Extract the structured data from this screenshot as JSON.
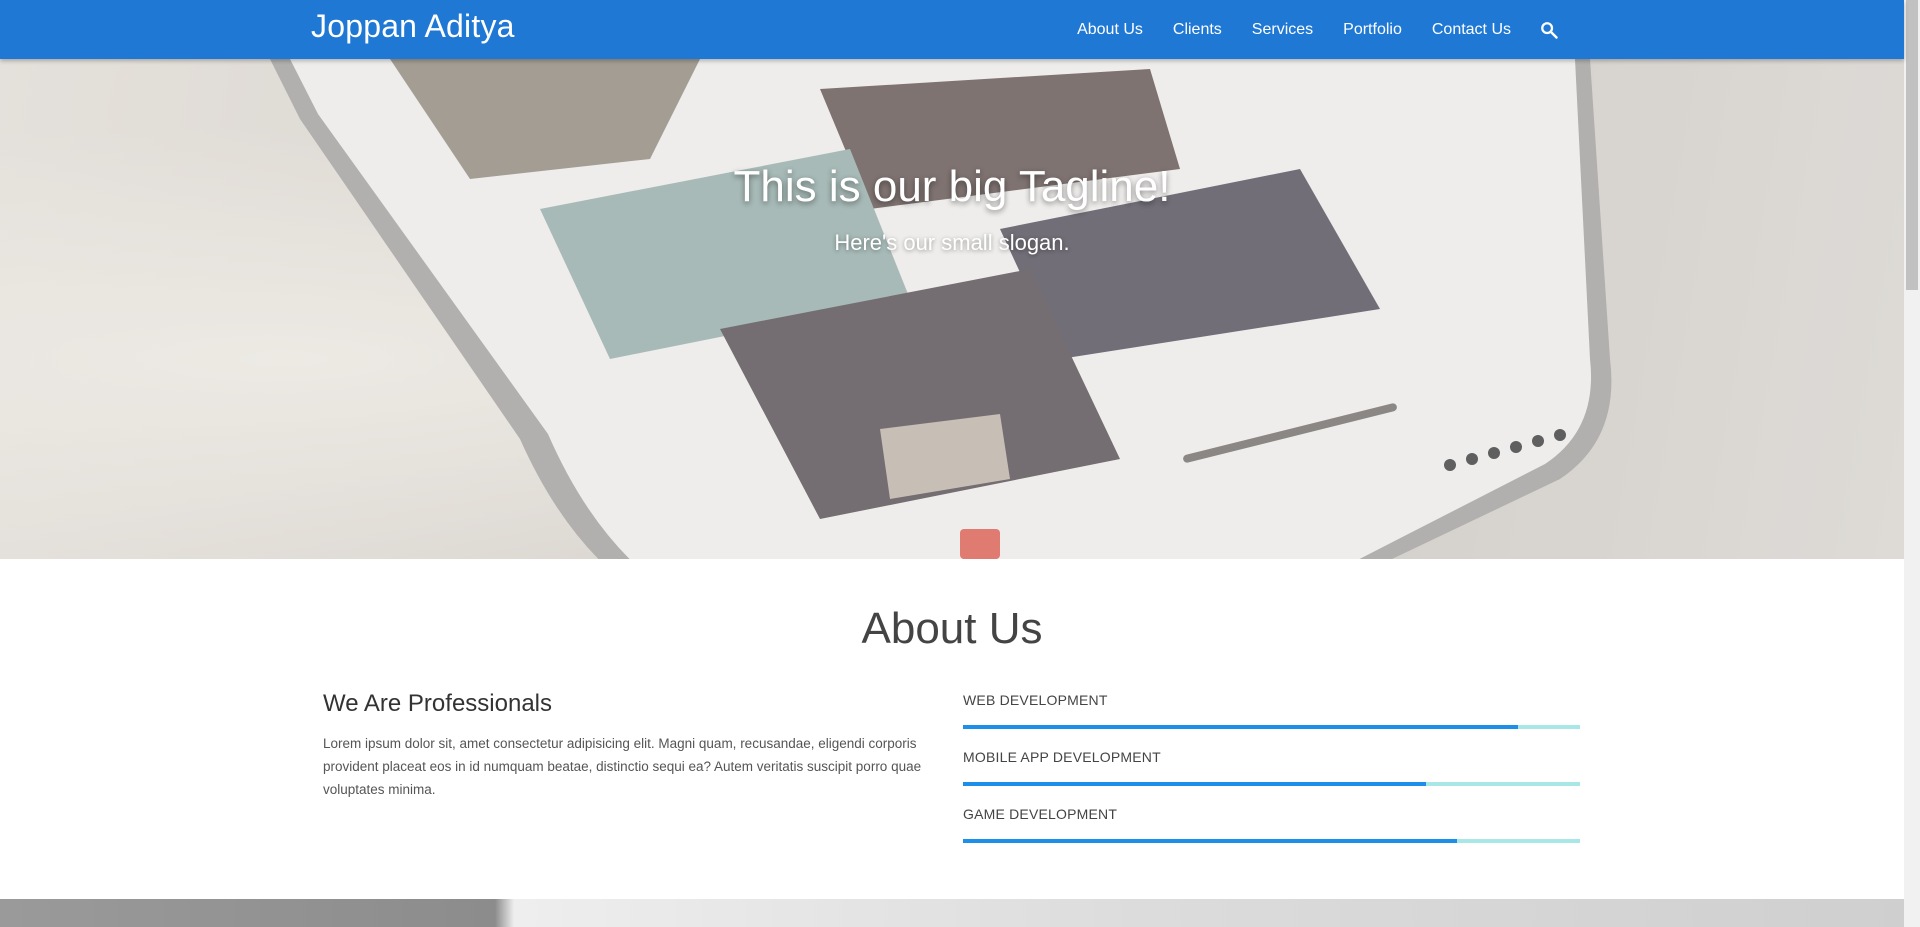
{
  "navbar": {
    "brand": "Joppan Aditya",
    "links": [
      "About Us",
      "Clients",
      "Services",
      "Portfolio",
      "Contact Us"
    ],
    "search_icon": "search-icon",
    "background": "#1e78d4"
  },
  "hero": {
    "title": "This is our big Tagline!",
    "subtitle": "Here's our small slogan."
  },
  "about": {
    "heading": "About Us",
    "subheading": "We Are Professionals",
    "body": "Lorem ipsum dolor sit, amet consectetur adipisicing elit. Magni quam, recusandae, eligendi corporis provident placeat eos in id numquam beatae, distinctio sequi ea? Autem veritatis suscipit porro quae voluptates minima.",
    "skills": [
      {
        "label": "WEB DEVELOPMENT",
        "percent": 90
      },
      {
        "label": "MOBILE APP DEVELOPMENT",
        "percent": 75
      },
      {
        "label": "GAME DEVELOPMENT",
        "percent": 80
      }
    ],
    "skill_fill_color": "#1e8fe8",
    "skill_track_color": "#a9e6e6"
  }
}
